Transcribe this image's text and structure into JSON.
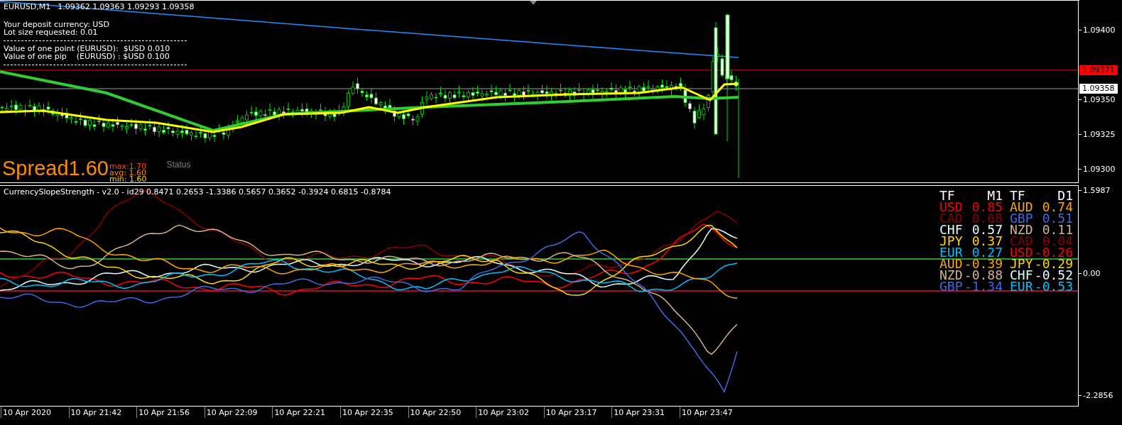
{
  "chart": {
    "symbol": "EURUSD,M1",
    "ohlc": "1.09362 1.09363 1.09293 1.09358",
    "info_lines": [
      "Your deposit currency: USD",
      "Lot size requested: 0.01"
    ],
    "value_lines": [
      "Value of one point (EURUSD):  $USD 0.010",
      "Value of one pip    (EURUSD) : $USD 0.100"
    ]
  },
  "spread": {
    "label": "Spread",
    "value": "1.60",
    "max": "max:1.70",
    "avg": "avg: 1.60",
    "min": "min: 1.60",
    "status": "Status"
  },
  "price_axis": {
    "ticks": [
      "1.09400",
      "1.09350",
      "1.09325",
      "1.09300"
    ],
    "tags": [
      {
        "label": "1.09371",
        "kind": "ask"
      },
      {
        "label": "1.09358",
        "kind": "bid"
      }
    ]
  },
  "indicator": {
    "title": "CurrencySlopeStrength - v2.0 - id29 0.8471 0.2653 -1.3386 0.5657 0.3652 -0.3924 0.6815 -0.8784",
    "axis_ticks": [
      "1.5987",
      "0.00",
      "-2.2856"
    ],
    "legend": {
      "columns": [
        {
          "tf_label": "TF",
          "timeframe": "M1",
          "entries": [
            {
              "currency": "USD",
              "value": "0.85",
              "color": "#ff0000"
            },
            {
              "currency": "CAD",
              "value": "0.68",
              "color": "#8b0000"
            },
            {
              "currency": "CHF",
              "value": "0.57",
              "color": "#e0ffff"
            },
            {
              "currency": "JPY",
              "value": "0.37",
              "color": "#ffd700"
            },
            {
              "currency": "EUR",
              "value": "0.27",
              "color": "#00bfff"
            },
            {
              "currency": "AUD",
              "value": "-0.39",
              "color": "#ffa500"
            },
            {
              "currency": "NZD",
              "value": "-0.88",
              "color": "#d2b48c"
            },
            {
              "currency": "GBP",
              "value": "-1.34",
              "color": "#4169e1"
            }
          ]
        },
        {
          "tf_label": "TF",
          "timeframe": "D1",
          "entries": [
            {
              "currency": "AUD",
              "value": "0.74",
              "color": "#ffa500"
            },
            {
              "currency": "GBP",
              "value": "0.51",
              "color": "#4169e1"
            },
            {
              "currency": "NZD",
              "value": "0.11",
              "color": "#d2b48c"
            },
            {
              "currency": "CAD",
              "value": "0.04",
              "color": "#8b0000"
            },
            {
              "currency": "USD",
              "value": "-0.26",
              "color": "#ff0000"
            },
            {
              "currency": "JPY",
              "value": "-0.29",
              "color": "#ffd700"
            },
            {
              "currency": "CHF",
              "value": "-0.52",
              "color": "#e0ffff"
            },
            {
              "currency": "EUR",
              "value": "-0.53",
              "color": "#00bfff"
            }
          ]
        }
      ]
    }
  },
  "time_axis": {
    "labels": [
      "10 Apr 2020",
      "10 Apr 21:42",
      "10 Apr 21:56",
      "10 Apr 22:09",
      "10 Apr 22:21",
      "10 Apr 22:35",
      "10 Apr 22:50",
      "10 Apr 23:02",
      "10 Apr 23:17",
      "10 Apr 23:31",
      "10 Apr 23:47"
    ]
  }
}
